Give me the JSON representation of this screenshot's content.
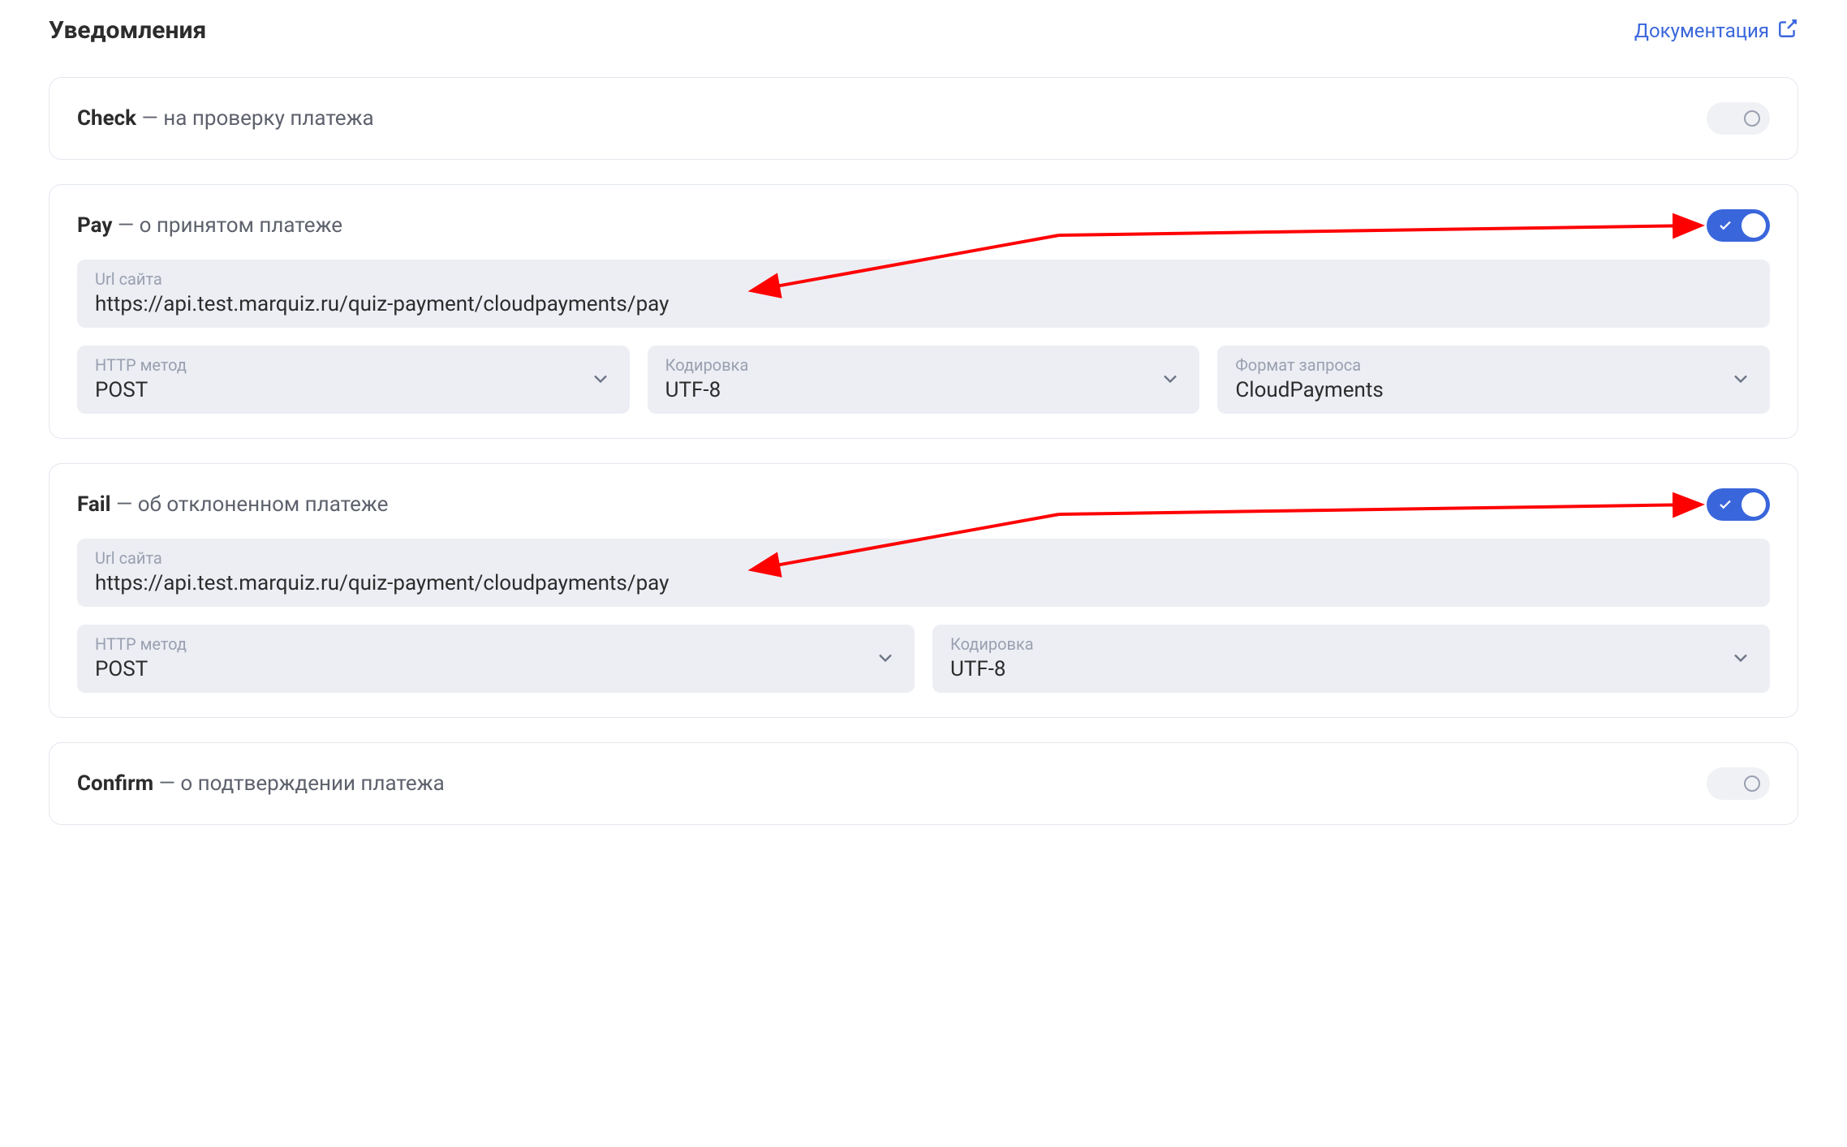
{
  "header": {
    "title": "Уведомления",
    "doc_link": "Документация"
  },
  "labels": {
    "url_label": "Url сайта",
    "http_method_label": "HTTP метод",
    "encoding_label": "Кодировка",
    "request_format_label": "Формат запроса"
  },
  "sections": {
    "check": {
      "name": "Check",
      "desc": " — на проверку платежа",
      "enabled": false
    },
    "pay": {
      "name": "Pay",
      "desc": " — о принятом платеже",
      "enabled": true,
      "url": "https://api.test.marquiz.ru/quiz-payment/cloudpayments/pay",
      "http_method": "POST",
      "encoding": "UTF-8",
      "request_format": "CloudPayments"
    },
    "fail": {
      "name": "Fail",
      "desc": " — об отклоненном платеже",
      "enabled": true,
      "url": "https://api.test.marquiz.ru/quiz-payment/cloudpayments/pay",
      "http_method": "POST",
      "encoding": "UTF-8"
    },
    "confirm": {
      "name": "Confirm",
      "desc": " — о подтверждении платежа",
      "enabled": false
    }
  },
  "annotations": {
    "color": "#ff0000"
  }
}
